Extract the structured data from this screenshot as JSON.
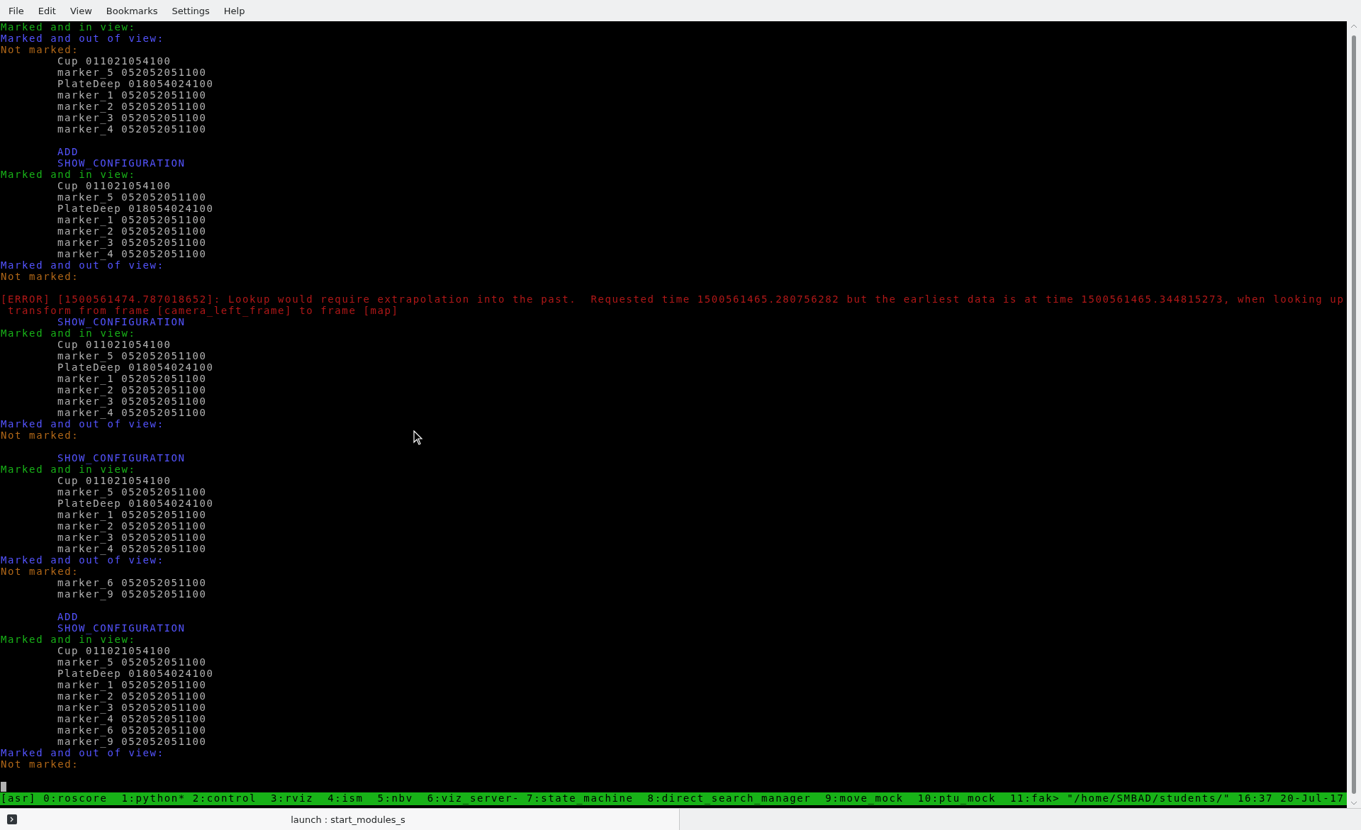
{
  "menu": [
    "File",
    "Edit",
    "View",
    "Bookmarks",
    "Settings",
    "Help"
  ],
  "lines": [
    {
      "kind": "in_view",
      "text": "Marked and in view:"
    },
    {
      "kind": "out_of_view",
      "text": "Marked and out of view:"
    },
    {
      "kind": "not_marked",
      "text": "Not marked:"
    },
    {
      "kind": "item",
      "text": "Cup 011021054100"
    },
    {
      "kind": "item",
      "text": "marker_5 052052051100"
    },
    {
      "kind": "item",
      "text": "PlateDeep 018054024100"
    },
    {
      "kind": "item",
      "text": "marker_1 052052051100"
    },
    {
      "kind": "item",
      "text": "marker_2 052052051100"
    },
    {
      "kind": "item",
      "text": "marker_3 052052051100"
    },
    {
      "kind": "item",
      "text": "marker_4 052052051100"
    },
    {
      "kind": "blank"
    },
    {
      "kind": "command",
      "text": "ADD"
    },
    {
      "kind": "command",
      "text": "SHOW_CONFIGURATION"
    },
    {
      "kind": "in_view",
      "text": "Marked and in view:"
    },
    {
      "kind": "item",
      "text": "Cup 011021054100"
    },
    {
      "kind": "item",
      "text": "marker_5 052052051100"
    },
    {
      "kind": "item",
      "text": "PlateDeep 018054024100"
    },
    {
      "kind": "item",
      "text": "marker_1 052052051100"
    },
    {
      "kind": "item",
      "text": "marker_2 052052051100"
    },
    {
      "kind": "item",
      "text": "marker_3 052052051100"
    },
    {
      "kind": "item",
      "text": "marker_4 052052051100"
    },
    {
      "kind": "out_of_view",
      "text": "Marked and out of view:"
    },
    {
      "kind": "not_marked",
      "text": "Not marked:"
    },
    {
      "kind": "blank"
    },
    {
      "kind": "error",
      "text": "[ERROR] [1500561474.787018652]: Lookup would require extrapolation into the past.  Requested time 1500561465.280756282 but the earliest data is at time 1500561465.344815273, when looking up"
    },
    {
      "kind": "error_cont",
      "text": "transform from frame [camera_left_frame] to frame [map]"
    },
    {
      "kind": "command",
      "text": "SHOW_CONFIGURATION"
    },
    {
      "kind": "in_view",
      "text": "Marked and in view:"
    },
    {
      "kind": "item",
      "text": "Cup 011021054100"
    },
    {
      "kind": "item",
      "text": "marker_5 052052051100"
    },
    {
      "kind": "item",
      "text": "PlateDeep 018054024100"
    },
    {
      "kind": "item",
      "text": "marker_1 052052051100"
    },
    {
      "kind": "item",
      "text": "marker_2 052052051100"
    },
    {
      "kind": "item",
      "text": "marker_3 052052051100"
    },
    {
      "kind": "item",
      "text": "marker_4 052052051100"
    },
    {
      "kind": "out_of_view",
      "text": "Marked and out of view:"
    },
    {
      "kind": "not_marked",
      "text": "Not marked:"
    },
    {
      "kind": "blank"
    },
    {
      "kind": "command",
      "text": "SHOW_CONFIGURATION"
    },
    {
      "kind": "in_view",
      "text": "Marked and in view:"
    },
    {
      "kind": "item",
      "text": "Cup 011021054100"
    },
    {
      "kind": "item",
      "text": "marker_5 052052051100"
    },
    {
      "kind": "item",
      "text": "PlateDeep 018054024100"
    },
    {
      "kind": "item",
      "text": "marker_1 052052051100"
    },
    {
      "kind": "item",
      "text": "marker_2 052052051100"
    },
    {
      "kind": "item",
      "text": "marker_3 052052051100"
    },
    {
      "kind": "item",
      "text": "marker_4 052052051100"
    },
    {
      "kind": "out_of_view",
      "text": "Marked and out of view:"
    },
    {
      "kind": "not_marked",
      "text": "Not marked:"
    },
    {
      "kind": "item",
      "text": "marker_6 052052051100"
    },
    {
      "kind": "item",
      "text": "marker_9 052052051100"
    },
    {
      "kind": "blank"
    },
    {
      "kind": "command",
      "text": "ADD"
    },
    {
      "kind": "command",
      "text": "SHOW_CONFIGURATION"
    },
    {
      "kind": "in_view",
      "text": "Marked and in view:"
    },
    {
      "kind": "item",
      "text": "Cup 011021054100"
    },
    {
      "kind": "item",
      "text": "marker_5 052052051100"
    },
    {
      "kind": "item",
      "text": "PlateDeep 018054024100"
    },
    {
      "kind": "item",
      "text": "marker_1 052052051100"
    },
    {
      "kind": "item",
      "text": "marker_2 052052051100"
    },
    {
      "kind": "item",
      "text": "marker_3 052052051100"
    },
    {
      "kind": "item",
      "text": "marker_4 052052051100"
    },
    {
      "kind": "item",
      "text": "marker_6 052052051100"
    },
    {
      "kind": "item",
      "text": "marker_9 052052051100"
    },
    {
      "kind": "out_of_view",
      "text": "Marked and out of view:"
    },
    {
      "kind": "not_marked",
      "text": "Not marked:"
    },
    {
      "kind": "blank"
    },
    {
      "kind": "cursor"
    }
  ],
  "status_bar": "[asr] 0:roscore  1:python* 2:control  3:rviz  4:ism  5:nbv  6:viz_server- 7:state_machine  8:direct_search_manager  9:move_mock  10:ptu_mock  11:fak> \"/home/SMBAD/students/\" 16:37 20-Jul-17",
  "tabs": [
    {
      "label": "launch : start_modules_s",
      "selected": true
    }
  ]
}
